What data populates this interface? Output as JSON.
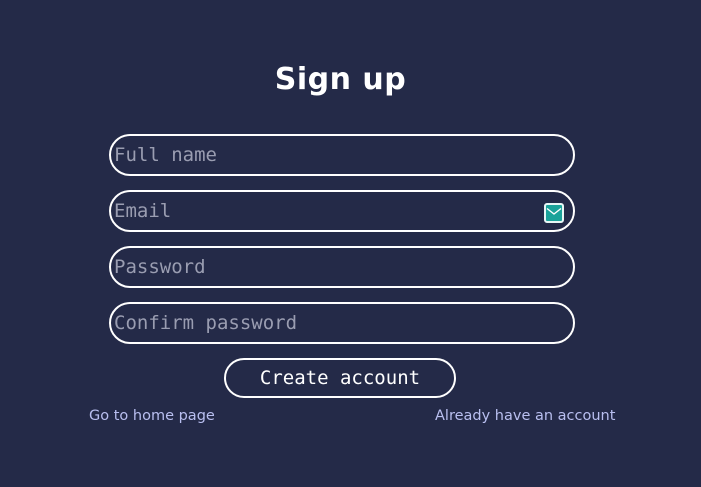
{
  "form": {
    "title": "Sign up",
    "fields": {
      "full_name": {
        "placeholder": "Full name",
        "value": ""
      },
      "email": {
        "placeholder": "Email",
        "value": "",
        "icon": "mail-icon"
      },
      "password": {
        "placeholder": "Password",
        "value": ""
      },
      "confirm_password": {
        "placeholder": "Confirm password",
        "value": ""
      }
    },
    "submit_label": "Create account"
  },
  "links": {
    "home": "Go to home page",
    "login": "Already have an account"
  },
  "colors": {
    "background": "#242a48",
    "text": "#ffffff",
    "placeholder": "#9a9db1",
    "link": "#b9bff0",
    "mail_icon": "#1aa39a"
  }
}
